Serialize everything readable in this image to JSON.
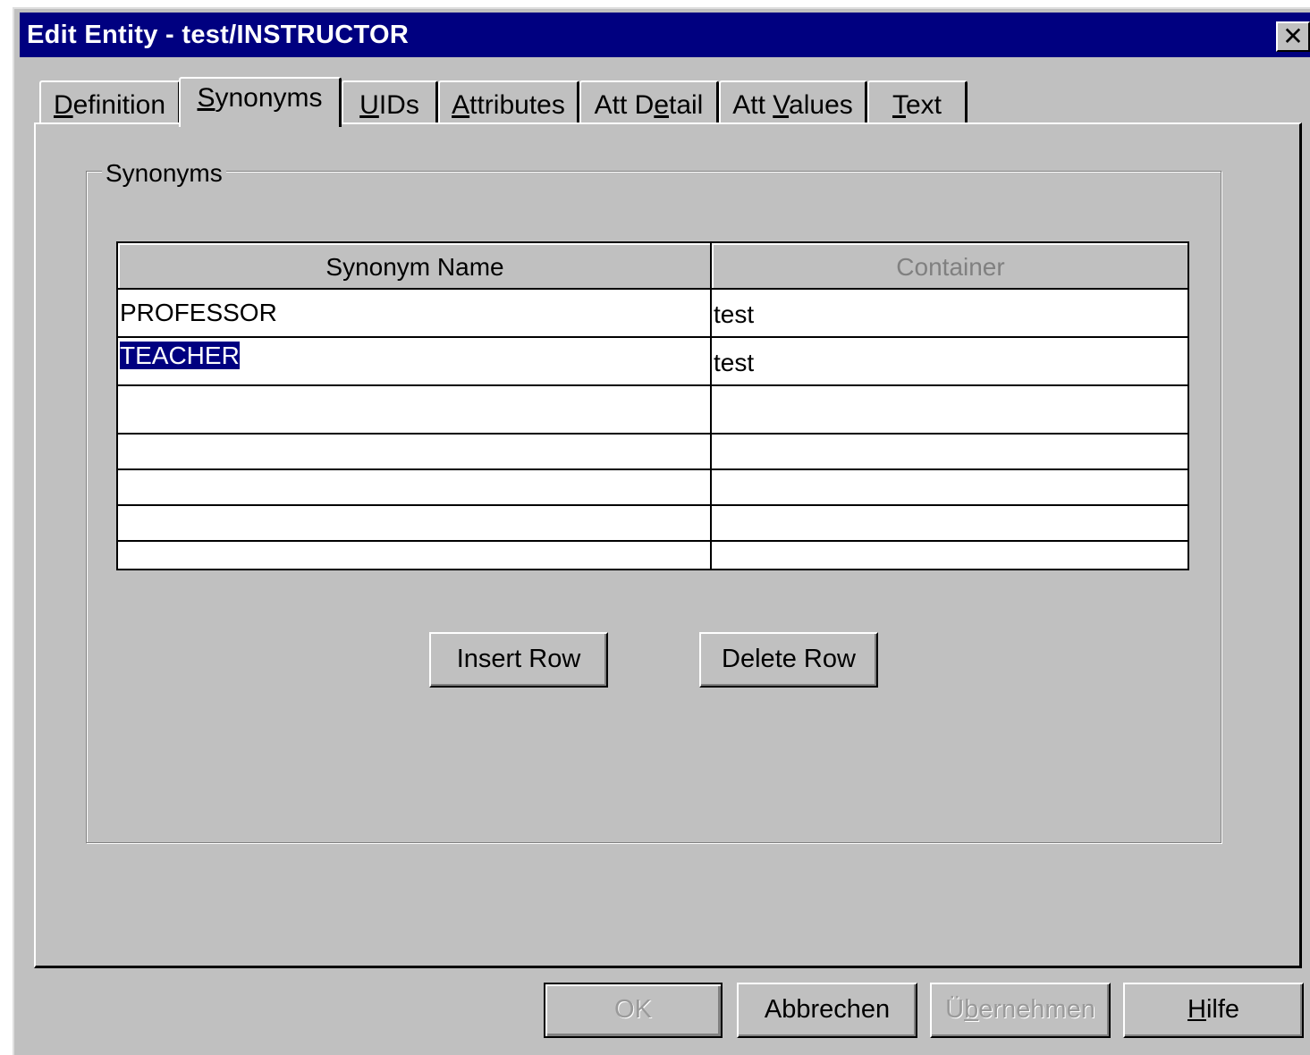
{
  "window": {
    "title": "Edit Entity - test/INSTRUCTOR",
    "close_glyph": "✕"
  },
  "tabs": [
    {
      "pre": "",
      "key": "D",
      "post": "efinition",
      "active": false
    },
    {
      "pre": "",
      "key": "S",
      "post": "ynonyms",
      "active": true
    },
    {
      "pre": "",
      "key": "U",
      "post": "IDs",
      "active": false
    },
    {
      "pre": "",
      "key": "A",
      "post": "ttributes",
      "active": false
    },
    {
      "pre": "Att D",
      "key": "e",
      "post": "tail",
      "active": false
    },
    {
      "pre": "Att ",
      "key": "V",
      "post": "alues",
      "active": false
    },
    {
      "pre": "",
      "key": "T",
      "post": "ext",
      "active": false
    }
  ],
  "groupbox": {
    "label": "Synonyms"
  },
  "grid": {
    "columns": [
      "Synonym Name",
      "Container"
    ],
    "rows": [
      {
        "name": "PROFESSOR",
        "container": "test"
      },
      {
        "name": "TEACHER",
        "container": "test",
        "selected": true
      },
      {
        "name": "",
        "container": ""
      },
      {
        "name": "",
        "container": ""
      },
      {
        "name": "",
        "container": ""
      },
      {
        "name": "",
        "container": ""
      },
      {
        "name": "",
        "container": ""
      }
    ]
  },
  "actions": {
    "insert_row": "Insert Row",
    "delete_row": "Delete Row"
  },
  "footer": {
    "ok": "OK",
    "cancel": "Abbrechen",
    "apply_pre": "Ü",
    "apply_key": "b",
    "apply_post": "ernehmen",
    "help_key": "H",
    "help_post": "ilfe"
  }
}
